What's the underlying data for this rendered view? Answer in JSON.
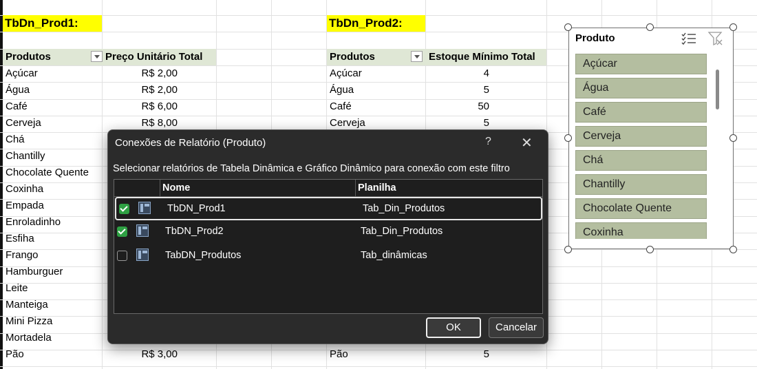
{
  "sheet": {
    "table1": {
      "title": "TbDn_Prod1:",
      "col_products": "Produtos",
      "col_value": "Preço Unitário Total",
      "rows": [
        {
          "name": "Açúcar",
          "value": "R$ 2,00"
        },
        {
          "name": "Água",
          "value": "R$ 2,00"
        },
        {
          "name": "Café",
          "value": "R$ 6,00"
        },
        {
          "name": "Cerveja",
          "value": "R$ 8,00"
        },
        {
          "name": "Chá",
          "value": ""
        },
        {
          "name": "Chantilly",
          "value": ""
        },
        {
          "name": "Chocolate Quente",
          "value": ""
        },
        {
          "name": "Coxinha",
          "value": ""
        },
        {
          "name": "Empada",
          "value": ""
        },
        {
          "name": "Enroladinho",
          "value": ""
        },
        {
          "name": "Esfiha",
          "value": ""
        },
        {
          "name": "Frango",
          "value": ""
        },
        {
          "name": "Hamburguer",
          "value": ""
        },
        {
          "name": "Leite",
          "value": ""
        },
        {
          "name": "Manteiga",
          "value": ""
        },
        {
          "name": "Mini Pizza",
          "value": ""
        },
        {
          "name": "Mortadela",
          "value": ""
        },
        {
          "name": "Pão",
          "value": "R$ 3,00"
        }
      ]
    },
    "table2": {
      "title": "TbDn_Prod2:",
      "col_products": "Produtos",
      "col_value": "Estoque Mínimo Total",
      "rows": [
        {
          "name": "Açúcar",
          "value": "4"
        },
        {
          "name": "Água",
          "value": "5"
        },
        {
          "name": "Café",
          "value": "50"
        },
        {
          "name": "Cerveja",
          "value": "5"
        },
        {
          "name": "Pão",
          "value": "5"
        }
      ]
    }
  },
  "slicer": {
    "title": "Produto",
    "multiselect_icon": "multi-select-icon",
    "clear_filter_icon": "clear-filter-icon",
    "items": [
      "Açúcar",
      "Água",
      "Café",
      "Cerveja",
      "Chá",
      "Chantilly",
      "Chocolate Quente",
      "Coxinha"
    ]
  },
  "dialog": {
    "title": "Conexões de Relatório (Produto)",
    "help": "?",
    "close": "✕",
    "instruction": "Selecionar relatórios de Tabela Dinâmica e Gráfico Dinâmico para conexão com este filtro",
    "col_name": "Nome",
    "col_sheet": "Planilha",
    "rows": [
      {
        "name": "TbDN_Prod1",
        "sheet": "Tab_Din_Produtos",
        "checked": true
      },
      {
        "name": "TbDN_Prod2",
        "sheet": "Tab_Din_Produtos",
        "checked": true
      },
      {
        "name": "TabDN_Produtos",
        "sheet": "Tab_dinâmicas",
        "checked": false
      }
    ],
    "ok_label": "OK",
    "cancel_label": "Cancelar"
  }
}
